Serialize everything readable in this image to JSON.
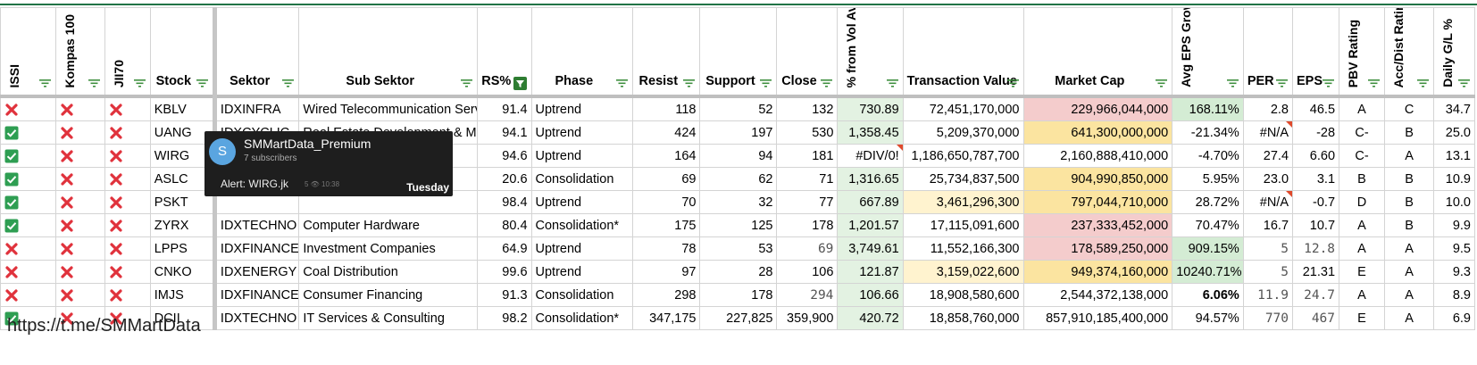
{
  "columns": [
    {
      "label": "ISSI",
      "rot": true
    },
    {
      "label": "Kompas 100",
      "rot": true
    },
    {
      "label": "JII70",
      "rot": true
    },
    {
      "label": "Stock"
    },
    {
      "label": "Sektor"
    },
    {
      "label": "Sub Sektor"
    },
    {
      "label": "RS%",
      "active": true
    },
    {
      "label": "Phase"
    },
    {
      "label": "Resist"
    },
    {
      "label": "Support"
    },
    {
      "label": "Close"
    },
    {
      "label": "% from Vol Avg",
      "rot": true
    },
    {
      "label": "Transaction Value"
    },
    {
      "label": "Market Cap"
    },
    {
      "label": "Avg EPS Growth Q (YoY)",
      "rot": true
    },
    {
      "label": "PER"
    },
    {
      "label": "EPS"
    },
    {
      "label": "PBV Rating",
      "rot": true
    },
    {
      "label": "Acc/Dist Rating",
      "rot": true
    },
    {
      "label": "Daily G/L %",
      "rot": true
    }
  ],
  "rows": [
    {
      "issi": "x",
      "kompas": "x",
      "jii": "x",
      "stock": "KBLV",
      "sektor": "IDXINFRA",
      "sub": "Wired Telecommunication Services",
      "rs": "91.4",
      "phase": "Uptrend",
      "resist": "118",
      "support": "52",
      "close": "132",
      "vol": "730.89",
      "tv": "72,451,170,000",
      "mcap": "229,966,044,000",
      "eps_g": "168.11%",
      "per": "2.8",
      "eps": "46.5",
      "pbv": "A",
      "acc": "C",
      "gl": "34.7"
    },
    {
      "issi": "ok",
      "kompas": "x",
      "jii": "x",
      "stock": "UANG",
      "sektor": "IDXCYCLIC",
      "sub": "Real Estate Development & Management",
      "rs": "94.1",
      "phase": "Uptrend",
      "resist": "424",
      "support": "197",
      "close": "530",
      "vol": "1,358.45",
      "tv": "5,209,370,000",
      "mcap": "641,300,000,000",
      "eps_g": "-21.34%",
      "per": "#N/A",
      "eps": "-28",
      "pbv": "C-",
      "acc": "B",
      "gl": "25.0"
    },
    {
      "issi": "ok",
      "kompas": "x",
      "jii": "x",
      "stock": "WIRG",
      "sektor": "",
      "sub": "",
      "rs": "94.6",
      "phase": "Uptrend",
      "resist": "164",
      "support": "94",
      "close": "181",
      "vol": "#DIV/0!",
      "tv": "1,186,650,787,700",
      "mcap": "2,160,888,410,000",
      "eps_g": "-4.70%",
      "per": "27.4",
      "eps": "6.60",
      "pbv": "C-",
      "acc": "A",
      "gl": "13.1"
    },
    {
      "issi": "ok",
      "kompas": "x",
      "jii": "x",
      "stock": "ASLC",
      "sektor": "",
      "sub": "",
      "rs": "20.6",
      "phase": "Consolidation",
      "resist": "69",
      "support": "62",
      "close": "71",
      "vol": "1,316.65",
      "tv": "25,734,837,500",
      "mcap": "904,990,850,000",
      "eps_g": "5.95%",
      "per": "23.0",
      "eps": "3.1",
      "pbv": "B",
      "acc": "B",
      "gl": "10.9"
    },
    {
      "issi": "ok",
      "kompas": "x",
      "jii": "x",
      "stock": "PSKT",
      "sektor": "",
      "sub": "",
      "rs": "98.4",
      "phase": "Uptrend",
      "resist": "70",
      "support": "32",
      "close": "77",
      "vol": "667.89",
      "tv": "3,461,296,300",
      "mcap": "797,044,710,000",
      "eps_g": "28.72%",
      "per": "#N/A",
      "eps": "-0.7",
      "pbv": "D",
      "acc": "B",
      "gl": "10.0"
    },
    {
      "issi": "ok",
      "kompas": "x",
      "jii": "x",
      "stock": "ZYRX",
      "sektor": "IDXTECHNO",
      "sub": "Computer Hardware",
      "rs": "80.4",
      "phase": "Consolidation*",
      "resist": "175",
      "support": "125",
      "close": "178",
      "vol": "1,201.57",
      "tv": "17,115,091,600",
      "mcap": "237,333,452,000",
      "eps_g": "70.47%",
      "per": "16.7",
      "eps": "10.7",
      "pbv": "A",
      "acc": "B",
      "gl": "9.9"
    },
    {
      "issi": "x",
      "kompas": "x",
      "jii": "x",
      "stock": "LPPS",
      "sektor": "IDXFINANCE",
      "sub": "Investment Companies",
      "rs": "64.9",
      "phase": "Uptrend",
      "resist": "78",
      "support": "53",
      "close": "69",
      "vol": "3,749.61",
      "tv": "11,552,166,300",
      "mcap": "178,589,250,000",
      "eps_g": "909.15%",
      "per": "5",
      "eps": "12.8",
      "pbv": "A",
      "acc": "A",
      "gl": "9.5"
    },
    {
      "issi": "x",
      "kompas": "x",
      "jii": "x",
      "stock": "CNKO",
      "sektor": "IDXENERGY",
      "sub": "Coal Distribution",
      "rs": "99.6",
      "phase": "Uptrend",
      "resist": "97",
      "support": "28",
      "close": "106",
      "vol": "121.87",
      "tv": "3,159,022,600",
      "mcap": "949,374,160,000",
      "eps_g": "10240.71%",
      "per": "5",
      "eps": "21.31",
      "pbv": "E",
      "acc": "A",
      "gl": "9.3"
    },
    {
      "issi": "x",
      "kompas": "x",
      "jii": "x",
      "stock": "IMJS",
      "sektor": "IDXFINANCE",
      "sub": "Consumer Financing",
      "rs": "91.3",
      "phase": "Consolidation",
      "resist": "298",
      "support": "178",
      "close": "294",
      "vol": "106.66",
      "tv": "18,908,580,600",
      "mcap": "2,544,372,138,000",
      "eps_g": "6.06%",
      "per": "11.9",
      "eps": "24.7",
      "pbv": "A",
      "acc": "A",
      "gl": "8.9"
    },
    {
      "issi": "ok",
      "kompas": "x",
      "jii": "x",
      "stock": "DCII",
      "sektor": "IDXTECHNO",
      "sub": "IT Services & Consulting",
      "rs": "98.2",
      "phase": "Consolidation*",
      "resist": "347,175",
      "support": "227,825",
      "close": "359,900",
      "vol": "420.72",
      "tv": "18,858,760,000",
      "mcap": "857,910,185,400,000",
      "eps_g": "94.57%",
      "per": "770",
      "eps": "467",
      "pbv": "E",
      "acc": "A",
      "gl": "6.9"
    }
  ],
  "popup": {
    "avatar": "S",
    "channel": "SMMartData_Premium",
    "subscribers": "7 subscribers",
    "alert": "Alert: WIRG.jk",
    "meta": "5 👁 10:38",
    "day": "Tuesday"
  },
  "footer": "https://t.me/SMMartData",
  "colors": {
    "check": "#2e9e52",
    "cross": "#e0323c",
    "sheet_green": "#217346"
  }
}
